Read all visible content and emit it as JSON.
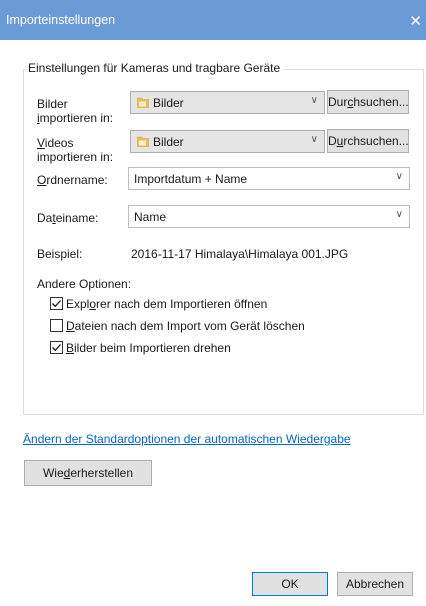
{
  "window": {
    "title": "Importeinstellungen",
    "close_glyph": "✕"
  },
  "group": {
    "legend": "Einstellungen für Kameras und tragbare Geräte"
  },
  "pictures": {
    "label_line1": "Bilder",
    "label_line2_u": "i",
    "label_line2_rest": "mportieren in:",
    "folder_value": "Bilder",
    "browse_pre": "Dur",
    "browse_u": "c",
    "browse_post": "hsuchen..."
  },
  "videos": {
    "label_line1_u": "V",
    "label_line1_rest": "ideos",
    "label_line2": "importieren in:",
    "folder_value": "Bilder",
    "browse_pre": "D",
    "browse_u": "u",
    "browse_post": "rchsuchen..."
  },
  "folder_name": {
    "label_u": "O",
    "label_rest": "rdnername:",
    "value": "Importdatum + Name"
  },
  "file_name": {
    "label_pre": "Da",
    "label_u": "t",
    "label_post": "einame:",
    "value": "Name"
  },
  "example": {
    "label": "Beispiel:",
    "value": "2016-11-17 Himalaya\\Himalaya 001.JPG"
  },
  "other_options": {
    "label": "Andere Optionen:",
    "items": [
      {
        "pre": "Expl",
        "u": "o",
        "post": "rer nach dem Importieren öffnen",
        "checked": true
      },
      {
        "pre": "",
        "u": "D",
        "post": "ateien nach dem Import vom Gerät löschen",
        "checked": false
      },
      {
        "pre": "",
        "u": "B",
        "post": "ilder beim Importieren drehen",
        "checked": true
      }
    ]
  },
  "autoplay_link": {
    "pre": "",
    "u": "Ä",
    "post": "ndern der Standardoptionen der automatischen Wiedergabe"
  },
  "restore_button": {
    "pre": "Wie",
    "u": "d",
    "post": "erherstellen"
  },
  "footer": {
    "ok_label": "OK",
    "cancel_label": "Abbrechen"
  },
  "colors": {
    "titlebar": "#6b9bd6",
    "link": "#0066cc",
    "default_button_border": "#0078d7"
  },
  "icons": {
    "folder": "folder-icon",
    "dropdown": "chevron-down-icon",
    "checkbox": "checkmark-icon",
    "close": "close-icon"
  }
}
